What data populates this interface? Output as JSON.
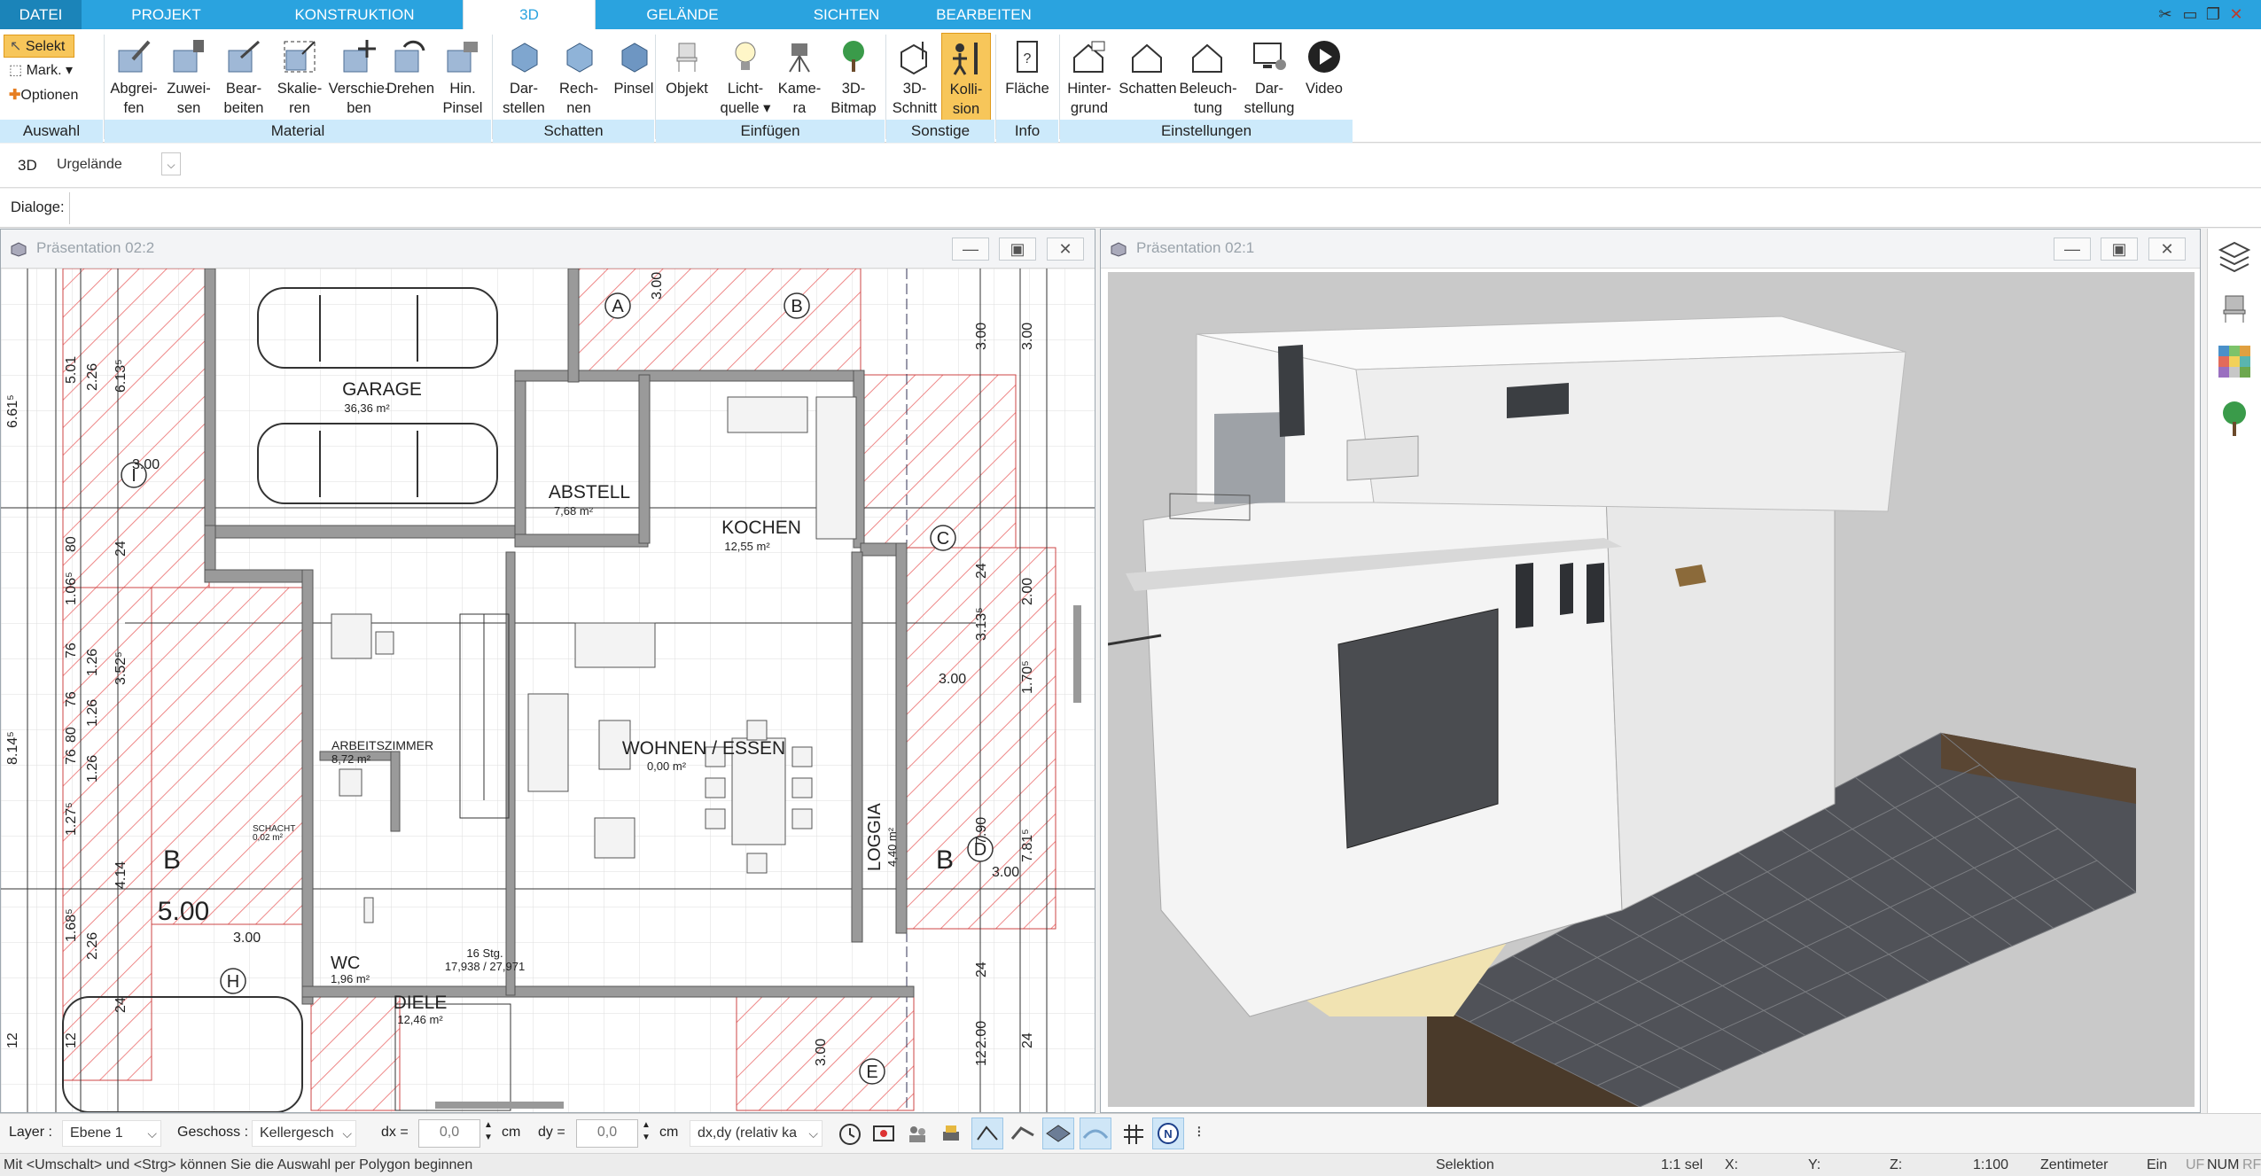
{
  "menu": {
    "tabs": [
      "DATEI",
      "PROJEKT",
      "KONSTRUKTION",
      "3D",
      "GELÄNDE",
      "SICHTEN",
      "BEARBEITEN"
    ],
    "active": "3D"
  },
  "ribbon": {
    "auswahl": {
      "selekt": "Selekt",
      "mark": "Mark.",
      "optionen": "Optionen",
      "group": "Auswahl"
    },
    "material": {
      "buttons": [
        [
          "Abgrei-",
          "fen"
        ],
        [
          "Zuwei-",
          "sen"
        ],
        [
          "Bear-",
          "beiten"
        ],
        [
          "Skalie-",
          "ren"
        ],
        [
          "Verschie-",
          "ben"
        ],
        [
          "Drehen",
          ""
        ],
        [
          "Hin.",
          "Pinsel"
        ]
      ],
      "group": "Material"
    },
    "schatten": {
      "buttons": [
        [
          "Dar-",
          "stellen"
        ],
        [
          "Rech-",
          "nen"
        ],
        [
          "Pinsel",
          ""
        ]
      ],
      "group": "Schatten"
    },
    "einfuegen": {
      "buttons": [
        [
          "Objekt",
          ""
        ],
        [
          "Licht-",
          "quelle ▾"
        ],
        [
          "Kame-",
          "ra"
        ],
        [
          "3D-",
          "Bitmap"
        ]
      ],
      "group": "Einfügen"
    },
    "sonstige": {
      "buttons": [
        [
          "3D-",
          "Schnitt"
        ],
        [
          "Kolli-",
          "sion"
        ]
      ],
      "group": "Sonstige"
    },
    "info": {
      "buttons": [
        [
          "Fläche",
          ""
        ]
      ],
      "group": "Info"
    },
    "einstellungen": {
      "buttons": [
        [
          "Hinter-",
          "grund"
        ],
        [
          "Schatten",
          ""
        ],
        [
          "Beleuch-",
          "tung"
        ],
        [
          "Dar-",
          "stellung"
        ],
        [
          "Video",
          ""
        ]
      ],
      "group": "Einstellungen"
    }
  },
  "row3d": {
    "label": "3D",
    "dropdown": "Urgelände"
  },
  "dialoge": {
    "label": "Dialoge:"
  },
  "panes": {
    "left": {
      "title": "Präsentation 02:2"
    },
    "right": {
      "title": "Präsentation 02:1"
    }
  },
  "plan": {
    "rooms": {
      "garage": "GARAGE",
      "garage_area": "36,36 m²",
      "abstell": "ABSTELL",
      "abstell_area": "7,68 m²",
      "kochen": "KOCHEN",
      "kochen_area": "12,55 m²",
      "arbeitszimmer": "ARBEITSZIMMER",
      "arbeitszimmer_area": "8,72 m²",
      "schacht": "SCHACHT",
      "schacht_area": "0,02 m²",
      "wohnen": "WOHNEN / ESSEN",
      "wohnen_area": "0,00 m²",
      "loggia": "LOGGIA",
      "loggia_area": "4,40 m²",
      "wc": "WC",
      "wc_area": "1,96 m²",
      "diele": "DIELE",
      "diele_area": "12,46 m²",
      "stair": "16 Stg.",
      "stair_dim": "17,938 / 27,971"
    },
    "axes": [
      "A",
      "B",
      "C",
      "D",
      "E",
      "H",
      "I"
    ],
    "section": "B",
    "big_dim": "5.00",
    "dims_left": [
      "6.61⁵",
      "5.01",
      "2.26",
      "6.13⁵",
      "80",
      "24",
      "1.06⁵",
      "76",
      "1.26",
      "3.52⁵",
      "76",
      "1.26",
      "80",
      "76",
      "1.26",
      "1.27⁵",
      "4.14",
      "1.68⁵",
      "2.26",
      "12",
      "8.14⁵",
      "24",
      "12"
    ],
    "dims_right": [
      "3.00",
      "3.00",
      "2.00",
      "3.13⁵",
      "1.70⁵",
      "24",
      "7.90",
      "7.81⁵",
      "2.00",
      "24",
      "12",
      "24"
    ],
    "dims_misc": [
      "3.00",
      "3.00",
      "3.00",
      "3.00",
      "3.00",
      "3.00"
    ]
  },
  "statusbar": {
    "layer_label": "Layer :",
    "layer": "Ebene 1",
    "geschoss_label": "Geschoss :",
    "geschoss": "Kellergesch",
    "dx_label": "dx =",
    "dx": "0,0",
    "dx_unit": "cm",
    "dy_label": "dy =",
    "dy": "0,0",
    "dy_unit": "cm",
    "mode": "dx,dy (relativ ka"
  },
  "status": {
    "hint": "Mit <Umschalt> und <Strg> können Sie die Auswahl per Polygon beginnen",
    "mode": "Selektion",
    "sel": "1:1 sel",
    "x": "X:",
    "y": "Y:",
    "z": "Z:",
    "scale": "1:100",
    "unit": "Zentimeter",
    "ein": "Ein",
    "uf": "UF",
    "num": "NUM",
    "rf": "RF"
  }
}
